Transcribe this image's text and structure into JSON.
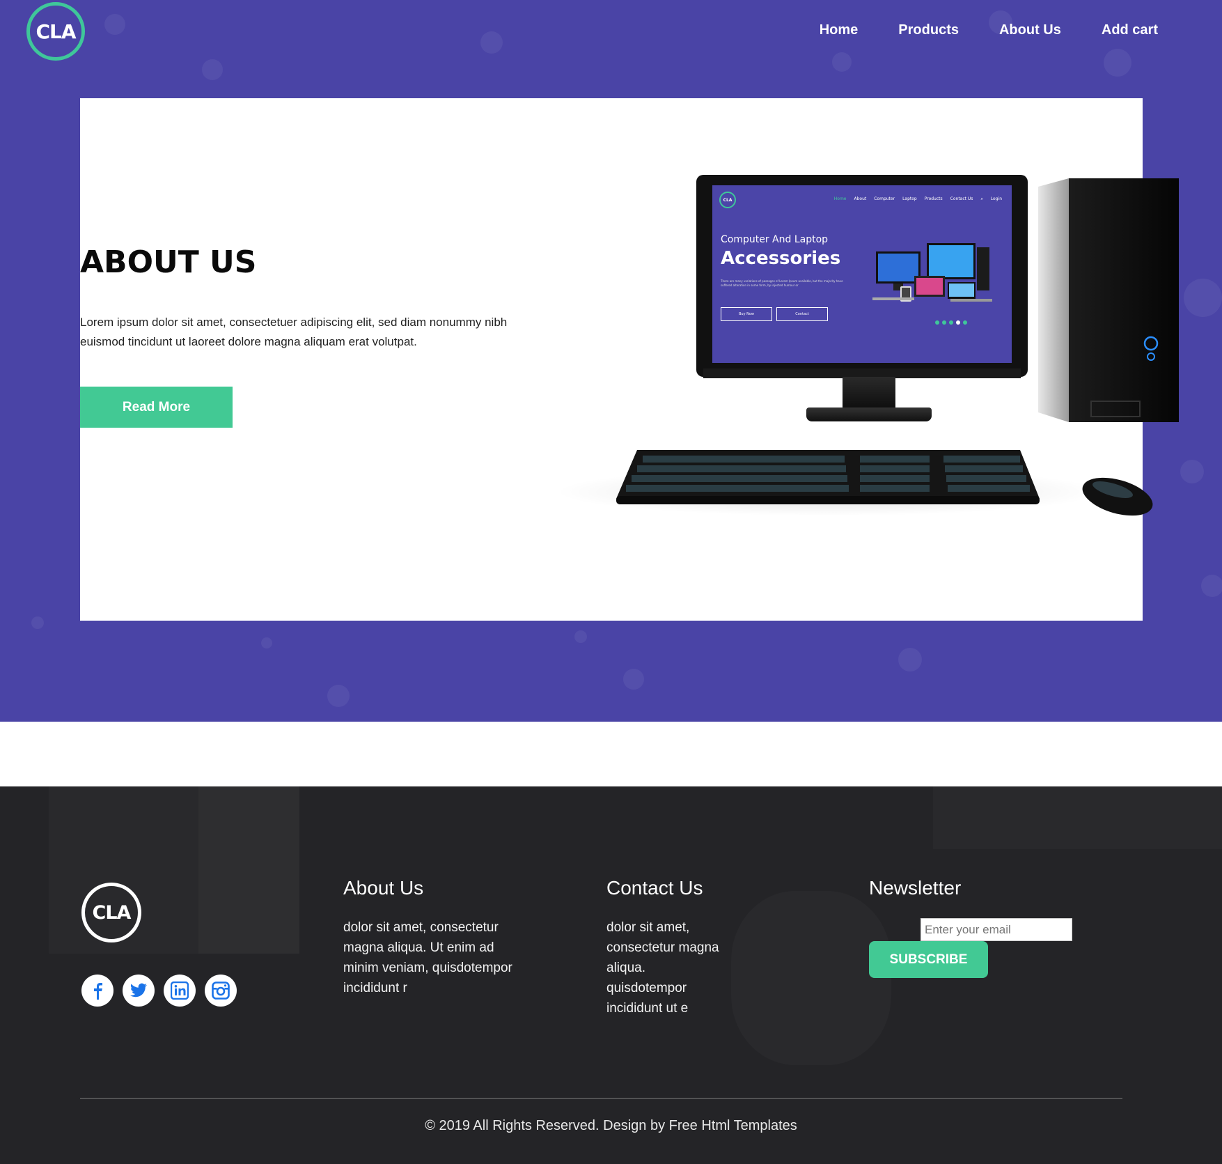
{
  "brand": {
    "logo_text": "CLA"
  },
  "nav": {
    "items": [
      {
        "label": "Home"
      },
      {
        "label": "Products"
      },
      {
        "label": "About Us"
      },
      {
        "label": "Add cart"
      }
    ]
  },
  "hero": {
    "title": "ABOUT US",
    "text": "Lorem ipsum dolor sit amet, consectetuer adipiscing elit, sed diam nonummy nibh euismod tincidunt ut laoreet dolore magna aliquam erat volutpat.",
    "button_label": "Read More"
  },
  "monitor_screen": {
    "logo_text": "CLA",
    "nav": [
      "Home",
      "About",
      "Computer",
      "Laptop",
      "Products",
      "Contact Us",
      "Login"
    ],
    "subtitle": "Computer And Laptop",
    "title": "Accessories",
    "body": "There are many variations of passages of Lorem Ipsum available, but the majority have suffered alteration in some form, by injected humour or",
    "buttons": [
      "Buy Now",
      "Contact"
    ]
  },
  "footer": {
    "logo_text": "CLA",
    "socials": [
      {
        "name": "facebook",
        "glyph": "f"
      },
      {
        "name": "twitter",
        "glyph": "t"
      },
      {
        "name": "linkedin",
        "glyph": "in"
      },
      {
        "name": "instagram",
        "glyph": "ig"
      }
    ],
    "about": {
      "heading": "About Us",
      "text": "dolor sit amet, consectetur magna aliqua. Ut enim ad minim veniam, quisdotempor incididunt r"
    },
    "contact": {
      "heading": "Contact Us",
      "text": "dolor sit amet, consectetur magna aliqua. quisdotempor incididunt ut e"
    },
    "newsletter": {
      "heading": "Newsletter",
      "placeholder": "Enter your email",
      "button_label": "SUBSCRIBE"
    },
    "copyright": "© 2019 All Rights Reserved. Design by Free Html Templates"
  },
  "colors": {
    "hero_bg": "#4a44a6",
    "accent": "#42c994",
    "footer_bg": "#242427",
    "social_blue": "#1a73e8"
  }
}
